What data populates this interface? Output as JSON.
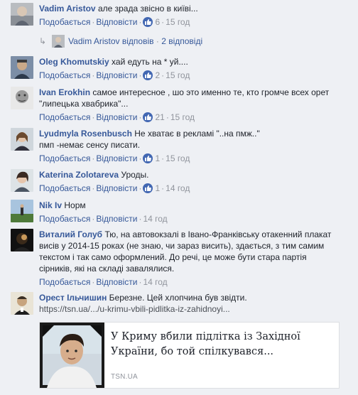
{
  "actions": {
    "like_label": "Подобається",
    "reply_label": "Відповісти"
  },
  "comments": [
    {
      "author": "Vadim Aristov",
      "lines": [
        "але зрада звісно в київі..."
      ],
      "likes": "6",
      "time": "15 год",
      "reply": {
        "author": "Vadim Aristov",
        "verb": "відповів",
        "count": "2 відповіді"
      }
    },
    {
      "author": "Oleg Khomutskiy",
      "lines": [
        "хай едуть на * уй...."
      ],
      "likes": "2",
      "time": "15 год"
    },
    {
      "author": "Ivan Erokhin",
      "lines": [
        "самое интересное , шо это именно те, кто громче всех орет",
        "\"липецька хвабрика\"..."
      ],
      "likes": "21",
      "time": "15 год"
    },
    {
      "author": "Lyudmyla Rosenbusch",
      "lines": [
        "Не хватає в рекламі \"..на пмж..\"",
        "пмп -немає сенсу писати."
      ],
      "likes": "1",
      "time": "15 год"
    },
    {
      "author": "Katerina Zolotareva",
      "lines": [
        "Уроды."
      ],
      "likes": "1",
      "time": "14 год"
    },
    {
      "author": "Nik Iv",
      "lines": [
        "Норм"
      ],
      "time": "14 год"
    },
    {
      "author": "Виталий Голуб",
      "lines": [
        "Тю, на автовокзалі в Івано-Франківську отакенний плакат",
        "висів у 2014-15 роках (не знаю, чи зараз висить), здається, з тим самим",
        "текстом і так само оформлений. До речі, це може бути стара партія",
        "сірників, які на складі завалялися."
      ],
      "time": "14 год"
    },
    {
      "author": "Орест Ільчишин",
      "lines": [
        "Березне. Цей хлопчина був звідти."
      ],
      "link": "https://tsn.ua/.../u-krimu-vbili-pidlitka-iz-zahidnoyi...",
      "preview": {
        "title": "У Криму вбили підлітка із Західної України, бо той спілкувався...",
        "domain": "TSN.UA"
      }
    }
  ]
}
